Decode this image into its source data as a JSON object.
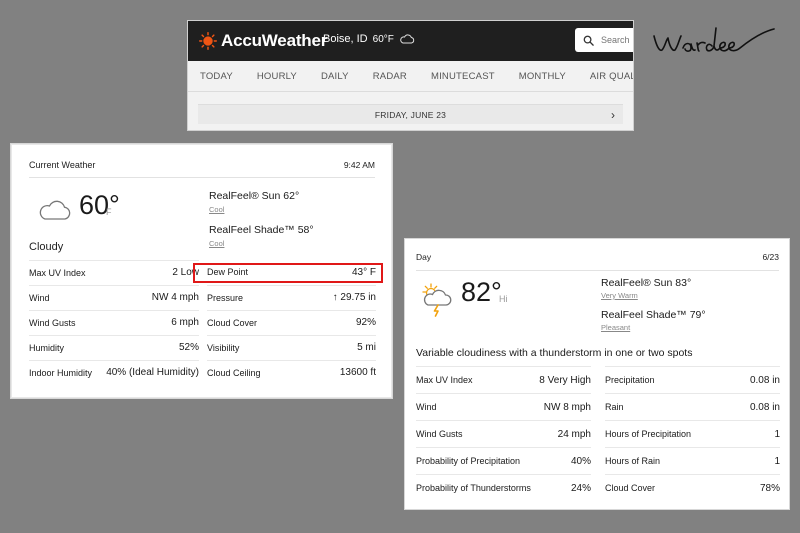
{
  "header": {
    "brand": "AccuWeather",
    "location": "Boise, ID",
    "location_temp": "60°F",
    "search_placeholder": "Search",
    "nav": [
      "TODAY",
      "HOURLY",
      "DAILY",
      "RADAR",
      "MINUTECAST",
      "MONTHLY",
      "AIR QUALITY"
    ],
    "date": "FRIDAY, JUNE 23"
  },
  "signature": "Wardee",
  "current": {
    "title": "Current Weather",
    "time": "9:42 AM",
    "temp": "60°",
    "unit": "F",
    "phrase": "Cloudy",
    "realfeel_sun": "RealFeel® Sun 62°",
    "realfeel_sun_desc": "Cool",
    "realfeel_shade": "RealFeel Shade™ 58°",
    "realfeel_shade_desc": "Cool",
    "left_rows": [
      {
        "label": "Max UV Index",
        "value": "2 Low"
      },
      {
        "label": "Wind",
        "value": "NW 4 mph"
      },
      {
        "label": "Wind Gusts",
        "value": "6 mph"
      },
      {
        "label": "Humidity",
        "value": "52%"
      },
      {
        "label": "Indoor Humidity",
        "value": "40% (Ideal Humidity)"
      }
    ],
    "right_rows": [
      {
        "label": "Dew Point",
        "value": "43° F"
      },
      {
        "label": "Pressure",
        "value": "↑ 29.75 in"
      },
      {
        "label": "Cloud Cover",
        "value": "92%"
      },
      {
        "label": "Visibility",
        "value": "5 mi"
      },
      {
        "label": "Cloud Ceiling",
        "value": "13600 ft"
      }
    ]
  },
  "day": {
    "title": "Day",
    "date": "6/23",
    "temp": "82°",
    "hi": "Hi",
    "realfeel_sun": "RealFeel® Sun 83°",
    "realfeel_sun_desc": "Very Warm",
    "realfeel_shade": "RealFeel Shade™ 79°",
    "realfeel_shade_desc": "Pleasant",
    "summary": "Variable cloudiness with a thunderstorm in one or two spots",
    "left_rows": [
      {
        "label": "Max UV Index",
        "value": "8 Very High"
      },
      {
        "label": "Wind",
        "value": "NW 8 mph"
      },
      {
        "label": "Wind Gusts",
        "value": "24 mph"
      },
      {
        "label": "Probability of Precipitation",
        "value": "40%"
      },
      {
        "label": "Probability of Thunderstorms",
        "value": "24%"
      }
    ],
    "right_rows": [
      {
        "label": "Precipitation",
        "value": "0.08 in"
      },
      {
        "label": "Rain",
        "value": "0.08 in"
      },
      {
        "label": "Hours of Precipitation",
        "value": "1"
      },
      {
        "label": "Hours of Rain",
        "value": "1"
      },
      {
        "label": "Cloud Cover",
        "value": "78%"
      }
    ]
  },
  "colors": {
    "background": "#818181",
    "topbar": "#1f1f1f",
    "accent_orange": "#f05514",
    "highlight_red": "#e01818"
  }
}
